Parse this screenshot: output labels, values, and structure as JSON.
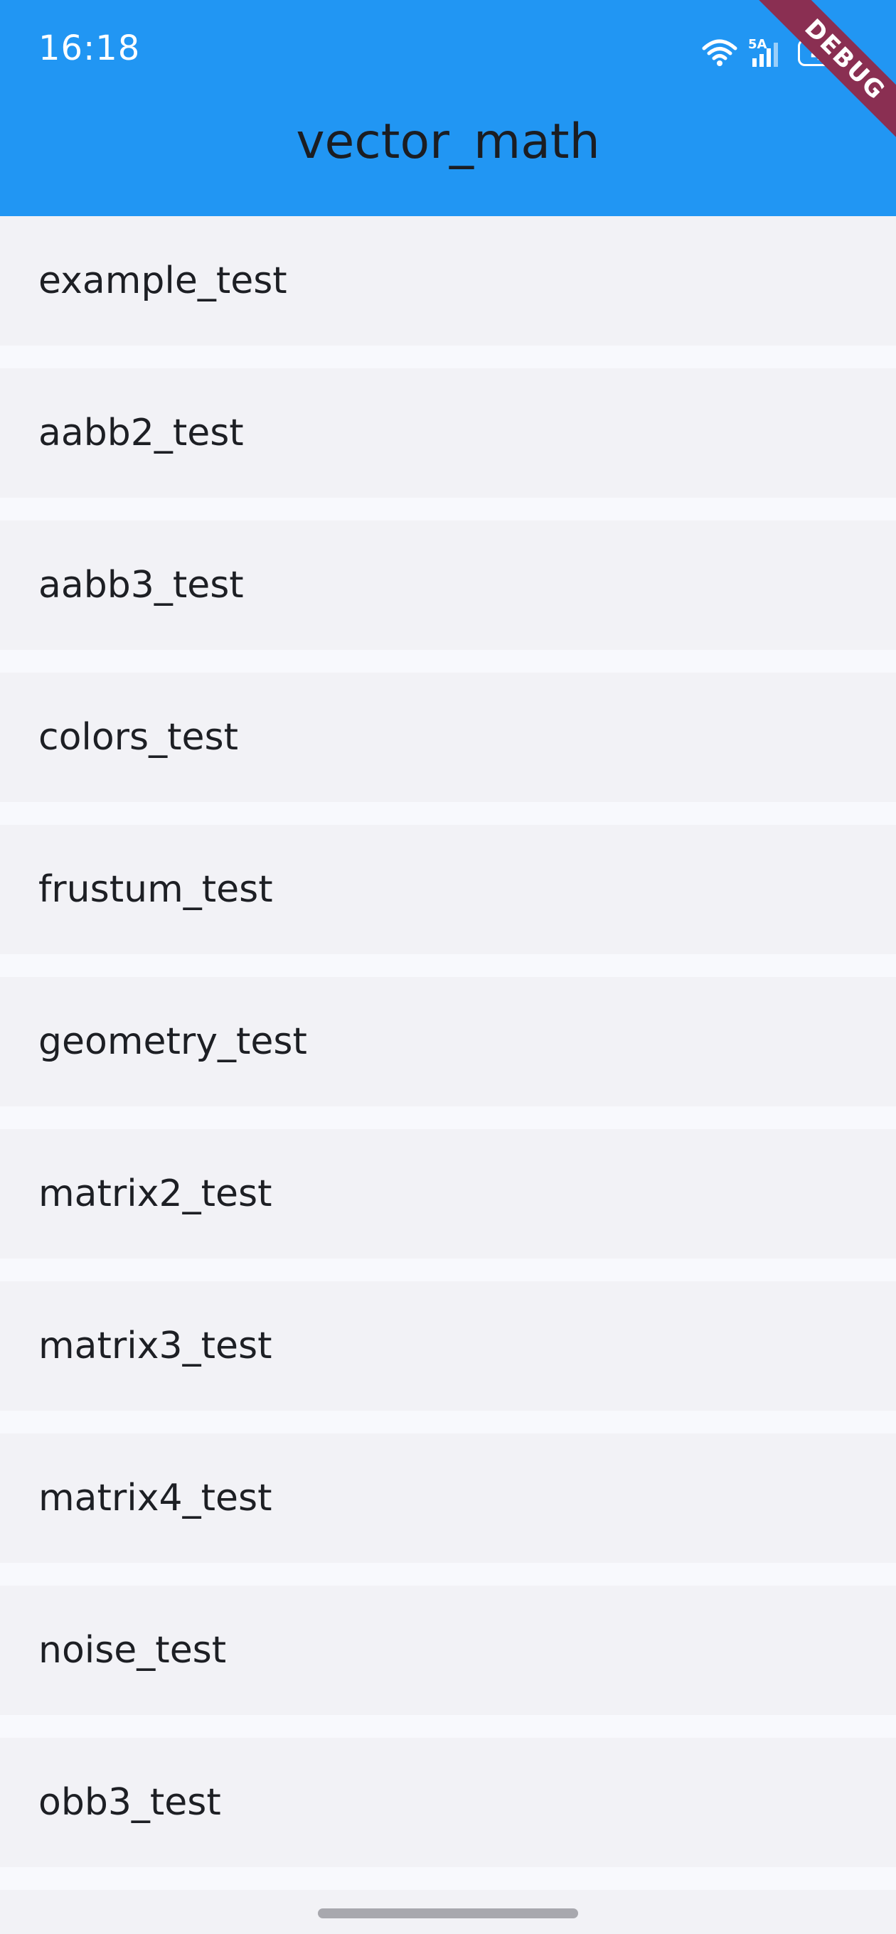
{
  "status_bar": {
    "time": "16:18",
    "network_label": "5A",
    "battery": "45"
  },
  "app_bar": {
    "title": "vector_math",
    "debug_banner": "DEBUG"
  },
  "tests": [
    {
      "label": "example_test"
    },
    {
      "label": "aabb2_test"
    },
    {
      "label": "aabb3_test"
    },
    {
      "label": "colors_test"
    },
    {
      "label": "frustum_test"
    },
    {
      "label": "geometry_test"
    },
    {
      "label": "matrix2_test"
    },
    {
      "label": "matrix3_test"
    },
    {
      "label": "matrix4_test"
    },
    {
      "label": "noise_test"
    },
    {
      "label": "obb3_test"
    },
    {
      "label": ""
    }
  ],
  "colors": {
    "app_bar": "#2196f3",
    "list_item": "#f2f2f6",
    "background": "#f8f9fd",
    "debug_banner": "#8a2f52"
  }
}
